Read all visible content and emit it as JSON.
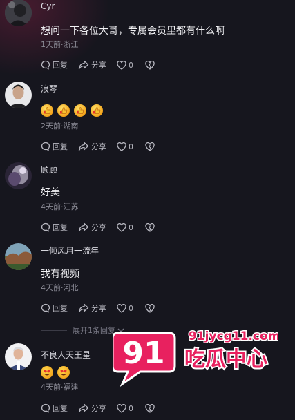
{
  "comments": [
    {
      "username": "Cyr",
      "text": "想问一下各位大哥，专属会员里都有什么啊",
      "meta": "1天前·浙江",
      "reply_label": "回复",
      "share_label": "分享",
      "like_count": "0"
    },
    {
      "username": "浪琴",
      "text": "",
      "meta": "2天前·湖南",
      "reply_label": "回复",
      "share_label": "分享",
      "like_count": "0"
    },
    {
      "username": "顾顾",
      "text": "好美",
      "meta": "4天前·江苏",
      "reply_label": "回复",
      "share_label": "分享",
      "like_count": "0"
    },
    {
      "username": "一倾风月一流年",
      "text": "我有视频",
      "meta": "4天前·河北",
      "reply_label": "回复",
      "share_label": "分享",
      "like_count": "0"
    },
    {
      "username": "不良人天王星",
      "text": "",
      "meta": "4天前·福建",
      "reply_label": "回复",
      "share_label": "分享",
      "like_count": "0"
    }
  ],
  "expand_replies": "展开1条回复",
  "watermark": {
    "number": "91",
    "domain": "91jycg11.com",
    "name": "吃瓜中心"
  },
  "colors": {
    "background": "#16161e",
    "watermark_pink": "#e8215f"
  }
}
